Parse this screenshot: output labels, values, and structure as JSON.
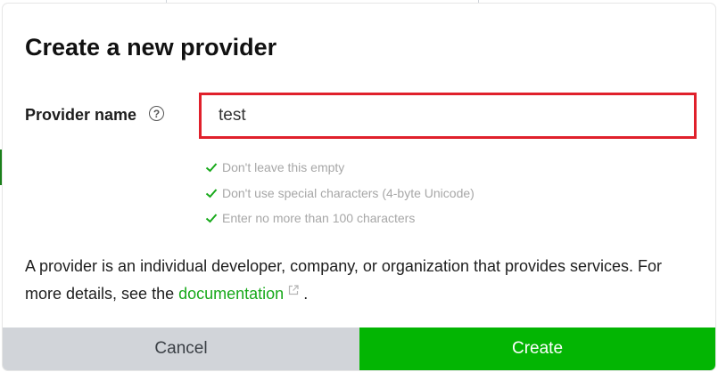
{
  "dialog": {
    "title": "Create a new provider",
    "field_label": "Provider name",
    "help_icon": "question-circle-icon",
    "input_value": "test",
    "rules": [
      {
        "text": "Don't leave this empty",
        "icon": "check-icon"
      },
      {
        "text": "Don't use special characters (4-byte Unicode)",
        "icon": "check-icon"
      },
      {
        "text": "Enter no more than 100 characters",
        "icon": "check-icon"
      }
    ],
    "description_pre": "A provider is an individual developer, company, or organization that provides services. For more details, see the ",
    "description_link": "documentation",
    "description_post": " .",
    "cancel_label": "Cancel",
    "create_label": "Create"
  },
  "colors": {
    "error_border": "#e0202b",
    "success": "#17a91a",
    "create_button": "#03b503",
    "cancel_button": "#d1d4d9"
  }
}
